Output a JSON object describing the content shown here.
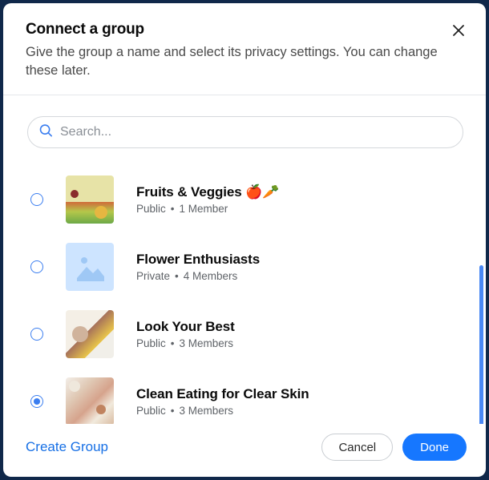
{
  "header": {
    "title": "Connect a group",
    "subtitle": "Give the group a name and select its privacy settings. You can change these later."
  },
  "search": {
    "placeholder": "Search..."
  },
  "groups": [
    {
      "title": "Fruits & Veggies 🍎🥕",
      "privacy": "Public",
      "members": "1 Member",
      "thumb": "fruits",
      "selected": false
    },
    {
      "title": "Flower Enthusiasts",
      "privacy": "Private",
      "members": "4 Members",
      "thumb": "flower",
      "selected": false
    },
    {
      "title": "Look Your Best",
      "privacy": "Public",
      "members": "3 Members",
      "thumb": "look",
      "selected": false
    },
    {
      "title": "Clean Eating for Clear Skin",
      "privacy": "Public",
      "members": "3 Members",
      "thumb": "clean",
      "selected": true
    }
  ],
  "footer": {
    "create": "Create Group",
    "cancel": "Cancel",
    "done": "Done"
  }
}
